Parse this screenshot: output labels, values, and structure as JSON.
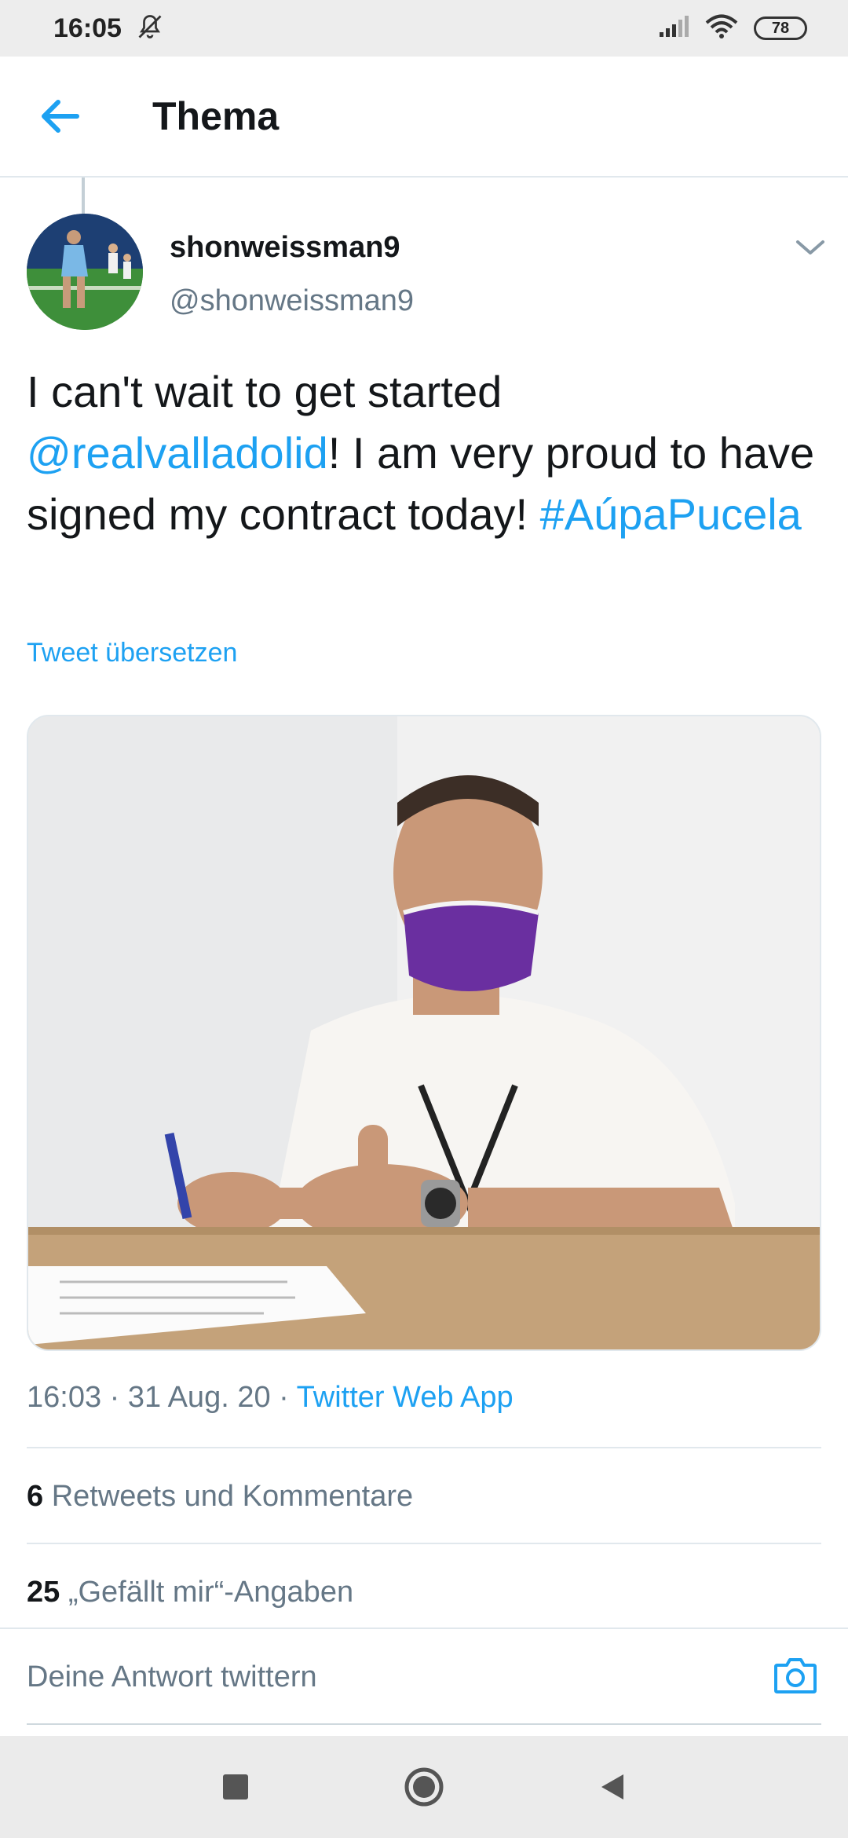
{
  "status_bar": {
    "time": "16:05",
    "battery": "78",
    "icons": [
      "notifications-off-icon",
      "signal-icon",
      "wifi-icon",
      "battery-icon"
    ]
  },
  "header": {
    "back_icon": "arrow-left-icon",
    "title": "Thema"
  },
  "tweet": {
    "user_name": "shonweissman9",
    "user_handle": "@shonweissman9",
    "text_part1": "I can't wait to get started ",
    "mention": "@realvalladolid",
    "text_part2": "! I am very proud to have signed my contract today! ",
    "hashtag": "#AúpaPucela",
    "translate": "Tweet übersetzen",
    "timestamp": "16:03 · 31 Aug. 20 · ",
    "source": "Twitter Web App",
    "retweets_count": "6",
    "retweets_label": " Retweets und Kommentare",
    "likes_count": "25",
    "likes_label": " „Gefällt mir“-Angaben"
  },
  "reply": {
    "placeholder": "Deine Antwort twittern",
    "camera_icon": "camera-icon"
  },
  "nav": {
    "icons": [
      "recents-square-icon",
      "home-circle-icon",
      "back-triangle-icon"
    ]
  },
  "colors": {
    "accent": "#1da1f2",
    "text": "#14171a",
    "muted": "#657786",
    "divider": "#e1e8ed"
  }
}
